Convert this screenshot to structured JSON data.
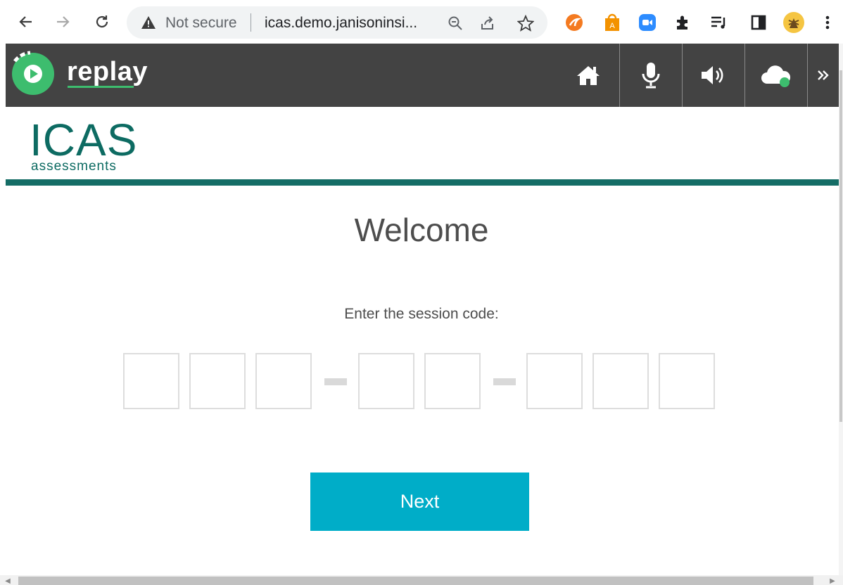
{
  "browser": {
    "omnibox": {
      "status_text": "Not secure",
      "url_text": "icas.demo.janisoninsi..."
    },
    "extensions": [
      "avast-extension-icon",
      "shopping-extension-icon",
      "zoom-extension-icon",
      "puzzle-icon",
      "media-queue-icon",
      "side-panel-icon",
      "profile-avatar"
    ],
    "menu": "kebab-menu-icon"
  },
  "replay": {
    "wordmark": "replay",
    "toolbar": [
      "home-icon",
      "microphone-icon",
      "speaker-icon",
      "cloud-status-icon",
      "double-chevron-icon"
    ],
    "accent": "#3dbd6e"
  },
  "brand": {
    "title": "ICAS",
    "subtitle": "assessments",
    "color": "#0d6b62"
  },
  "main": {
    "heading": "Welcome",
    "prompt": "Enter the session code:",
    "code_groups": [
      {
        "boxes": [
          "",
          "",
          ""
        ]
      },
      {
        "boxes": [
          "",
          "",
          ""
        ]
      },
      {
        "boxes": [
          "",
          "",
          ""
        ]
      }
    ],
    "next_label": "Next",
    "next_color": "#00adc8"
  }
}
